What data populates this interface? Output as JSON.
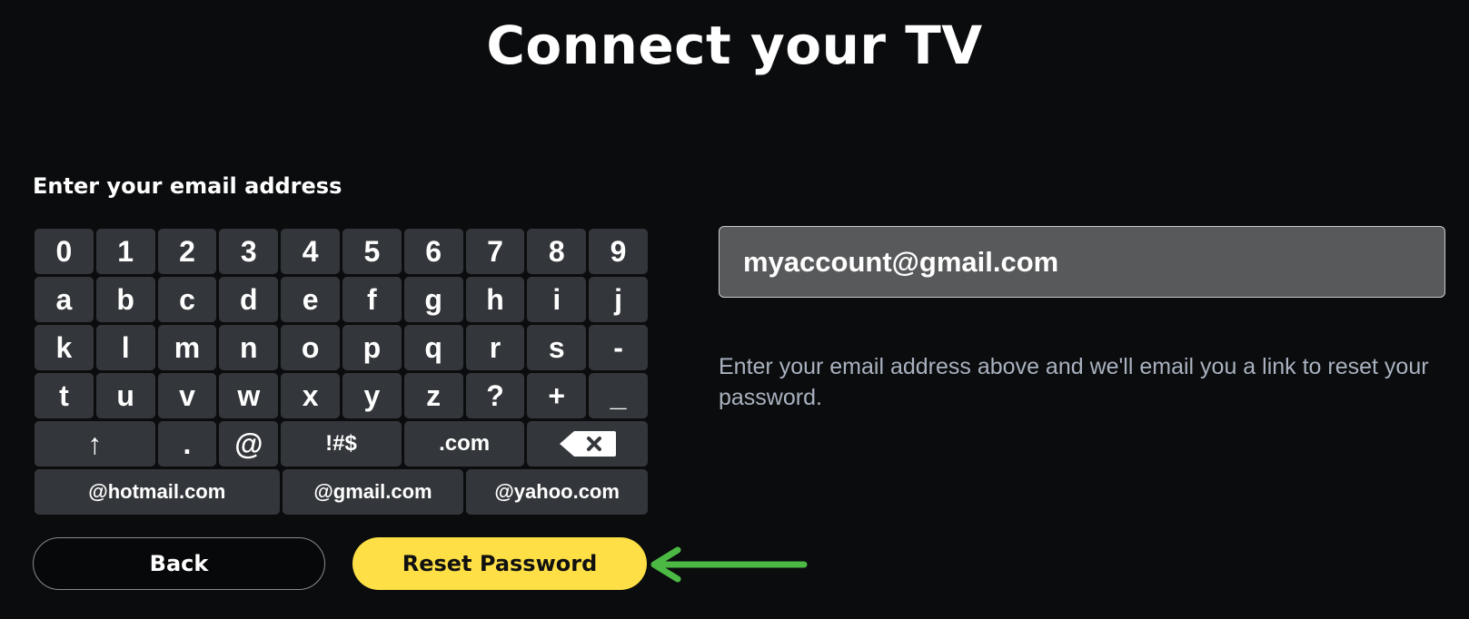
{
  "page": {
    "title": "Connect your TV",
    "section_label": "Enter your email address"
  },
  "keyboard": {
    "rows": [
      [
        "0",
        "1",
        "2",
        "3",
        "4",
        "5",
        "6",
        "7",
        "8",
        "9"
      ],
      [
        "a",
        "b",
        "c",
        "d",
        "e",
        "f",
        "g",
        "h",
        "i",
        "j"
      ],
      [
        "k",
        "l",
        "m",
        "n",
        "o",
        "p",
        "q",
        "r",
        "s",
        "-"
      ],
      [
        "t",
        "u",
        "v",
        "w",
        "x",
        "y",
        "z",
        "?",
        "+",
        "_"
      ]
    ],
    "special_row": {
      "shift_glyph": "↑",
      "dot": ".",
      "at": "@",
      "symbols": "!#$",
      "dotcom": ".com",
      "backspace_icon": "backspace-icon"
    },
    "domain_row": [
      "@hotmail.com",
      "@gmail.com",
      "@yahoo.com"
    ]
  },
  "email_input": {
    "value": "myaccount@gmail.com"
  },
  "help_text": "Enter your email address above and we'll email you a link to reset your password.",
  "buttons": {
    "back_label": "Back",
    "reset_label": "Reset Password"
  },
  "colors": {
    "background": "#0b0c0e",
    "key": "#33363a",
    "accent_yellow": "#fedf45",
    "annotation_green": "#4cb944",
    "help_text": "#a9b2bf"
  }
}
